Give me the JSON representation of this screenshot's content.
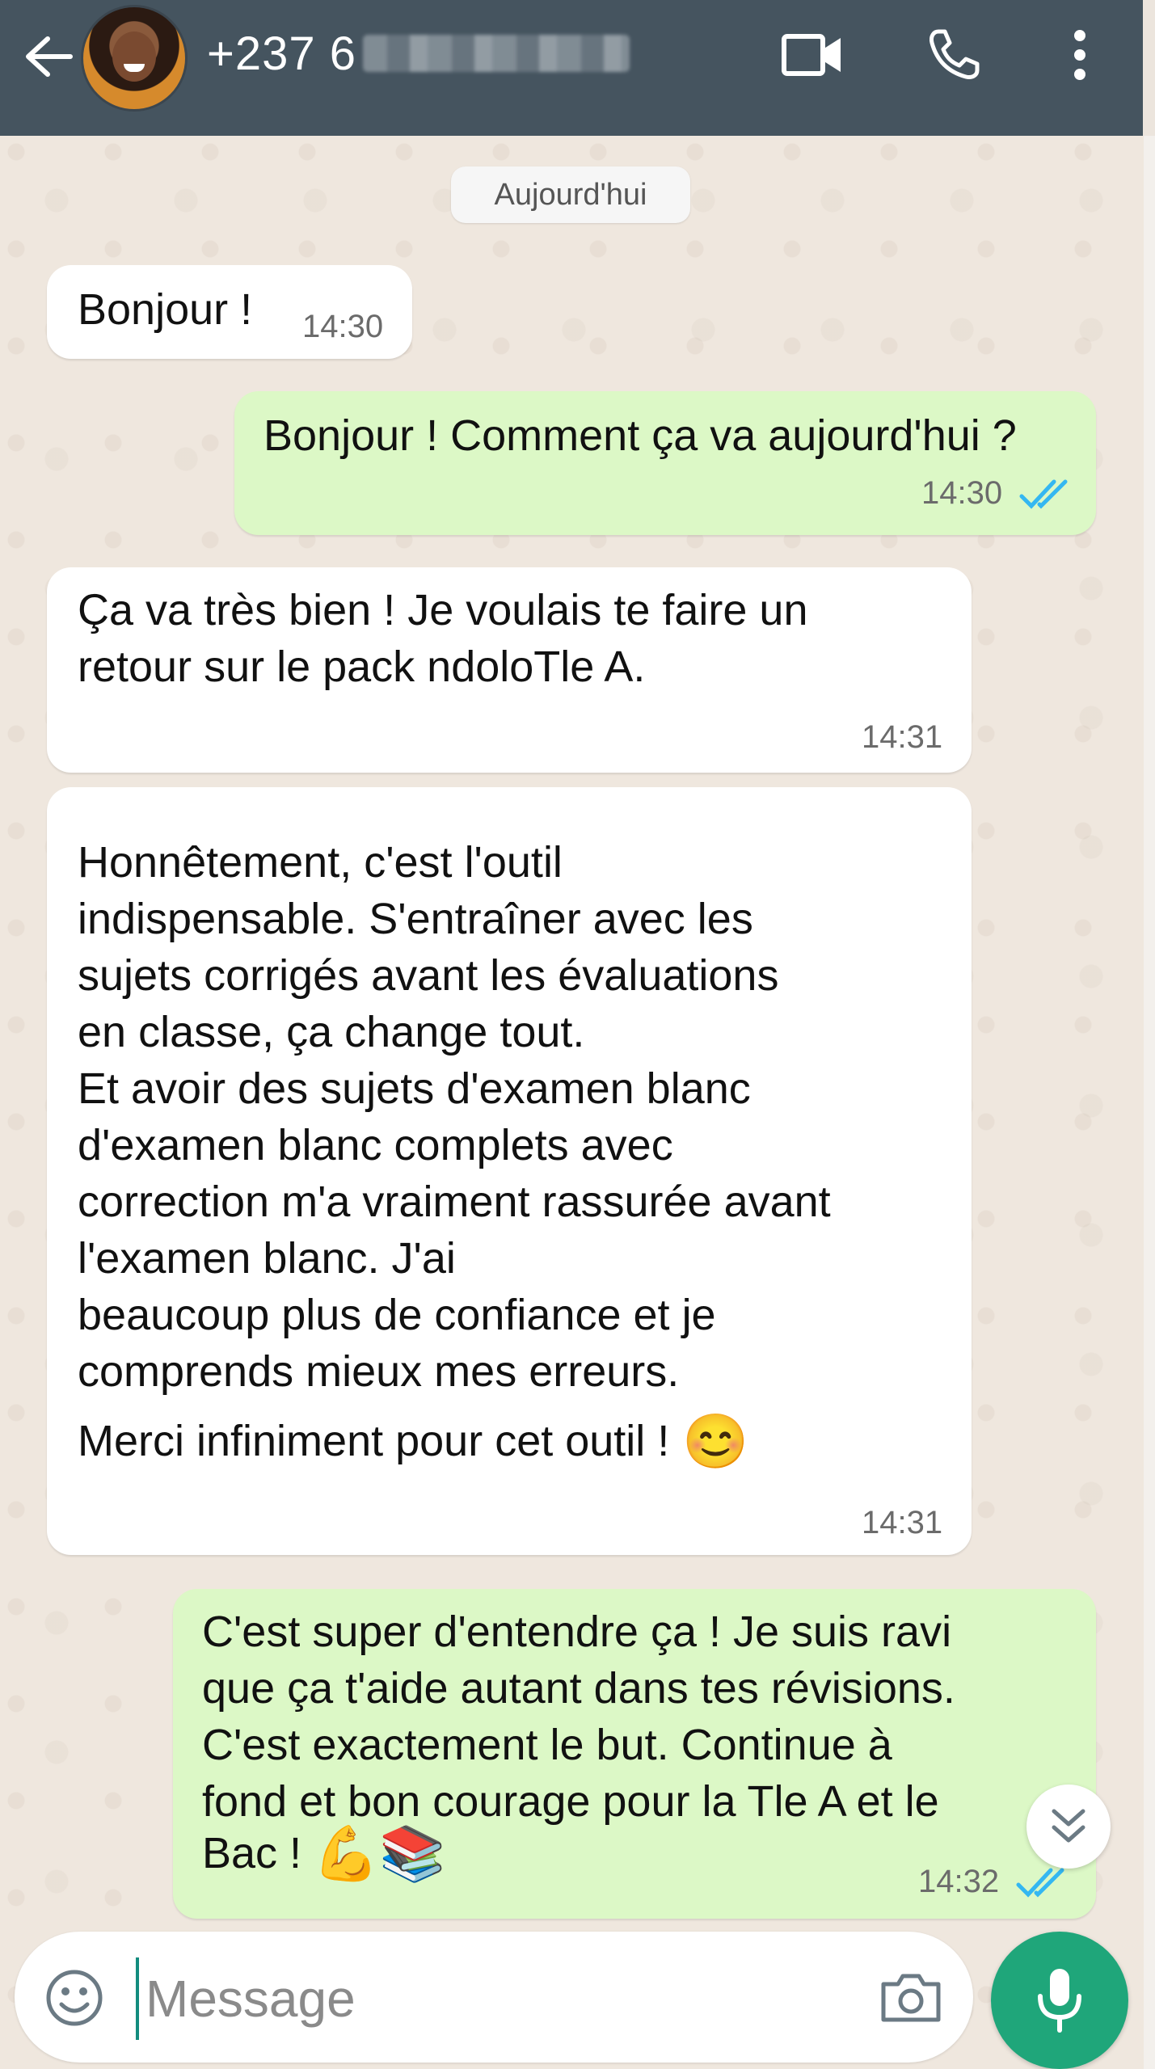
{
  "header": {
    "contact_number": "+237 6",
    "icons": [
      "back-arrow-icon",
      "video-call-icon",
      "phone-icon",
      "more-vert-icon"
    ]
  },
  "date_chip": "Aujourd'hui",
  "messages": [
    {
      "direction": "in",
      "text": "Bonjour !",
      "time": "14:30"
    },
    {
      "direction": "out",
      "text": "Bonjour ! Comment ça va aujourd'hui ?",
      "time": "14:30",
      "status": "read"
    },
    {
      "direction": "in",
      "text": "Ça va très bien ! Je voulais te faire un\nretour sur le pack ndoloTle A.",
      "time": "14:31"
    },
    {
      "direction": "in",
      "text": "Honnêtement, c'est l'outil\nindispensable. S'entraîner avec les\nsujets corrigés avant les évaluations\nen classe, ça change tout.\nEt avoir des sujets d'examen blanc\nd'examen blanc complets avec\ncorrection m'a vraiment rassurée avant\nl'examen blanc. J'ai\nbeaucoup plus de confiance et je\ncomprends mieux mes erreurs.",
      "text2": "Merci infiniment pour cet outil !",
      "emoji": "😊",
      "time": "14:31"
    },
    {
      "direction": "out",
      "text": "C'est super d'entendre ça ! Je suis ravi\nque ça t'aide autant dans tes révisions.\nC'est exactement le but. Continue à\nfond et bon courage pour la Tle A et le",
      "text2": "Bac !",
      "emoji": "💪📚",
      "time": "14:32",
      "status": "read"
    }
  ],
  "composer": {
    "placeholder": "Message"
  },
  "colors": {
    "header_bg": "#45545f",
    "outgoing_bubble": "#dcf8c6",
    "incoming_bubble": "#ffffff",
    "read_ticks": "#34b7f1",
    "mic_button": "#1fa67a"
  }
}
